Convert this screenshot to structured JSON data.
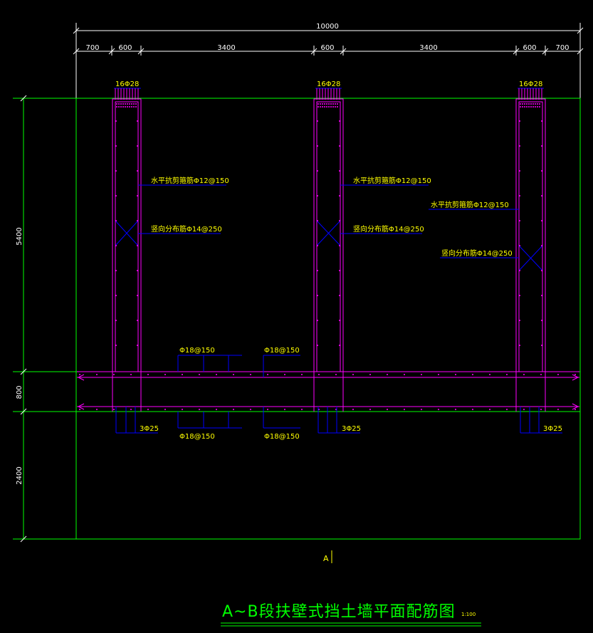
{
  "title": "A~B段扶壁式挡土墙平面配筋图",
  "scale": "1:100",
  "axis_label": "A",
  "dims_top": {
    "total": "10000",
    "segments": [
      "700",
      "600",
      "3400",
      "600",
      "3400",
      "600",
      "700"
    ]
  },
  "dims_left": [
    "5400",
    "800",
    "2400"
  ],
  "notes": {
    "col_rebar": [
      "16Φ28",
      "16Φ28",
      "16Φ28"
    ],
    "horiz_shear_1": "水平抗剪箍筋Φ12@150",
    "horiz_shear_2": "水平抗剪箍筋Φ12@150",
    "horiz_shear_3": "水平抗剪箍筋Φ12@150",
    "vert_dist_1": "竖向分布筋Φ14@250",
    "vert_dist_2": "竖向分布筋Φ14@250",
    "vert_dist_3": "竖向分布筋Φ14@250",
    "top_slab_1": "Φ18@150",
    "top_slab_2": "Φ18@150",
    "bot_slab_1": "Φ18@150",
    "bot_slab_2": "Φ18@150",
    "bot_bars": [
      "3Φ25",
      "3Φ25",
      "3Φ25"
    ]
  },
  "colors": {
    "background": "#000000",
    "outline": "#00ff00",
    "rebar": "#ff00ff",
    "leader": "#0000ff",
    "text": "#ffff00",
    "dimension": "#ffffff"
  }
}
